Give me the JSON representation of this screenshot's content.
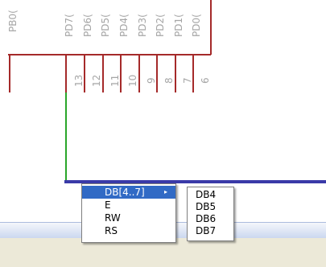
{
  "schematic": {
    "pin_labels": [
      "PB0(",
      "PD7(",
      "PD6(",
      "PD5(",
      "PD4(",
      "PD3(",
      "PD2(",
      "PD1(",
      "PD0("
    ],
    "pin_numbers": [
      "13",
      "12",
      "11",
      "10",
      "9",
      "8",
      "7",
      "6"
    ],
    "colors": {
      "outline": "#a52a2a",
      "wire": "#2aa62a",
      "bus": "#3a3aa8"
    }
  },
  "context_menu": {
    "items": [
      "DB[4..7]",
      "E",
      "RW",
      "RS"
    ],
    "submenu_arrow": "▸"
  },
  "submenu": {
    "items": [
      "DB4",
      "DB5",
      "DB6",
      "DB7"
    ]
  }
}
